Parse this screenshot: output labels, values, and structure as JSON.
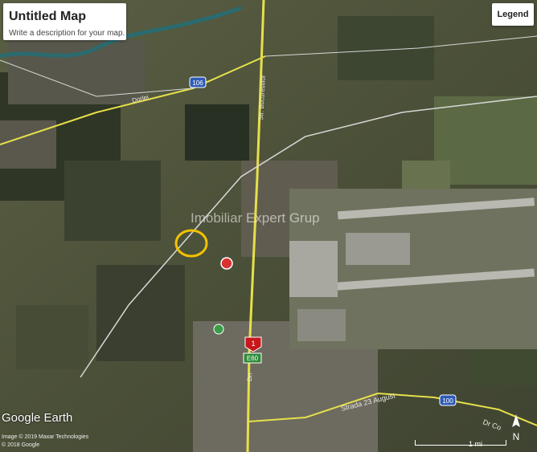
{
  "panel": {
    "title": "Untitled Map",
    "description": "Write a description for your map."
  },
  "legend_button": "Legend",
  "watermark": "Imobiliar Expert Grup",
  "brand": "Google Earth",
  "credits": [
    "Image © 2019 Maxar Technologies",
    "© 2018 Google"
  ],
  "scale_label": "1 mi",
  "road_labels": {
    "route_top": "106",
    "route_bottom": "100",
    "route_main": "1",
    "euro_route": "E60",
    "road_left_top": "Dorlei",
    "road_main": "Str. Bucurestilor",
    "road_south": "Dn",
    "road_bottom": "Strada 23 August",
    "road_bottom_right": "Dr Co"
  },
  "marker": {
    "name": "yellow circle",
    "color": "#f2c200"
  },
  "colors": {
    "road_yellow": "#e6e04a",
    "road_white": "#d8d8d8",
    "route_blue": "#2f5bb7",
    "route_red": "#c8161d"
  }
}
